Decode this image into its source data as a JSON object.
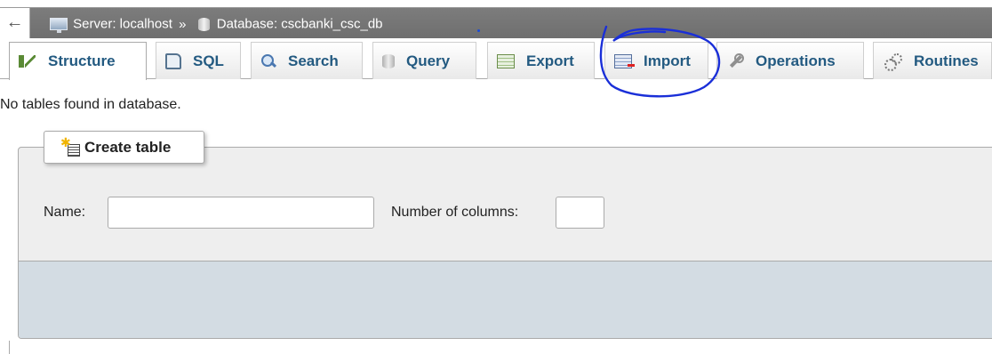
{
  "breadcrumb": {
    "back_glyph": "←",
    "server_label": "Server: localhost",
    "separator": "»",
    "database_label": "Database: cscbanki_csc_db"
  },
  "tabs": [
    {
      "label": "Structure",
      "icon": "structure-icon",
      "active": true
    },
    {
      "label": "SQL",
      "icon": "sql-icon"
    },
    {
      "label": "Search",
      "icon": "search-icon"
    },
    {
      "label": "Query",
      "icon": "query-icon"
    },
    {
      "label": "Export",
      "icon": "export-icon"
    },
    {
      "label": "Import",
      "icon": "import-icon"
    },
    {
      "label": "Operations",
      "icon": "wrench-icon"
    },
    {
      "label": "Routines",
      "icon": "routines-icon"
    }
  ],
  "notice": "No tables found in database.",
  "create_table": {
    "legend": "Create table",
    "name_label": "Name:",
    "name_value": "",
    "columns_label": "Number of columns:",
    "columns_value": ""
  },
  "colors": {
    "topbar": "#777777",
    "tab_text": "#235a81",
    "annotation": "#1a2fd8",
    "fieldset_bg": "#eeeeee",
    "footer_band": "#d3dce3"
  }
}
